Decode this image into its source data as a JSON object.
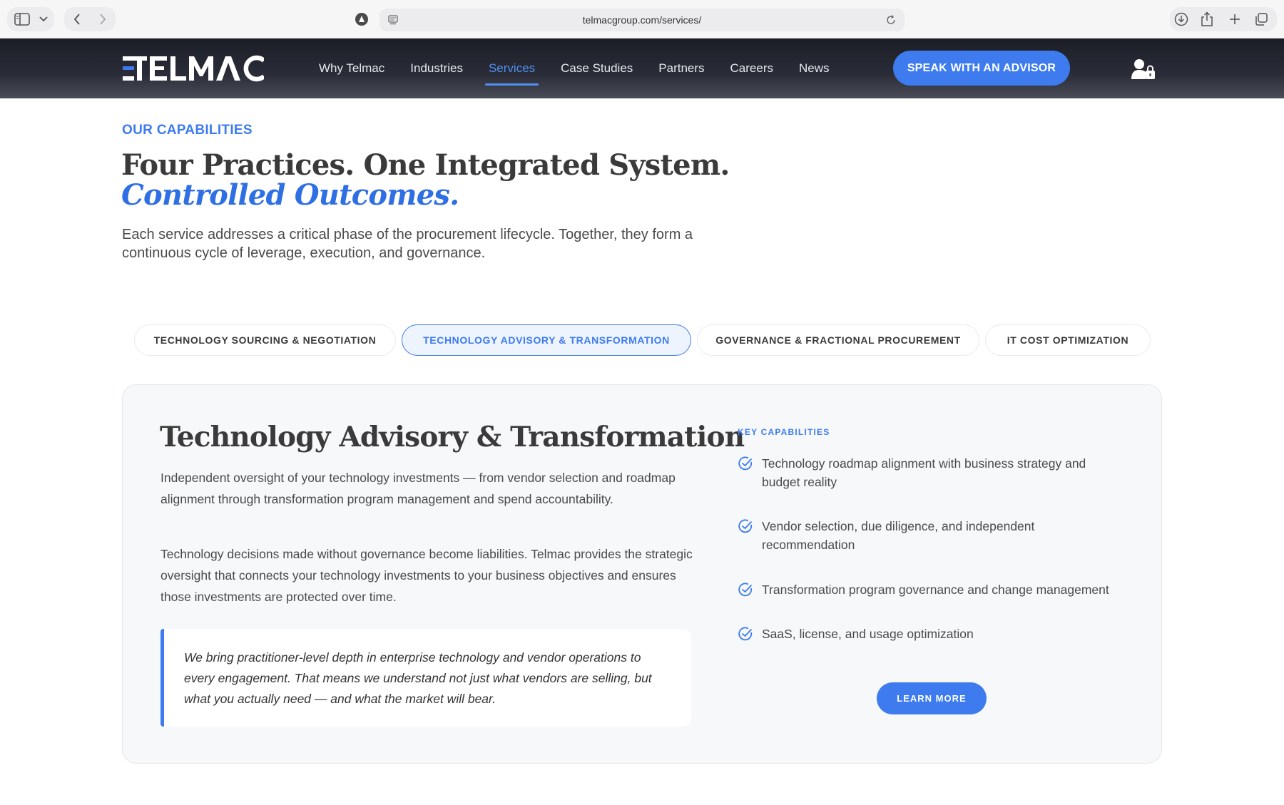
{
  "browser": {
    "url": "telmacgroup.com/services/"
  },
  "header": {
    "logo_text": "TELMAC",
    "nav": [
      {
        "label": "Why Telmac"
      },
      {
        "label": "Industries"
      },
      {
        "label": "Services"
      },
      {
        "label": "Case Studies"
      },
      {
        "label": "Partners"
      },
      {
        "label": "Careers"
      },
      {
        "label": "News"
      }
    ],
    "active_nav": "Services",
    "cta_label": "SPEAK WITH AN ADVISOR"
  },
  "intro": {
    "eyebrow": "OUR CAPABILITIES",
    "headline": "Four Practices. One Integrated System.",
    "headline_accent": "Controlled Outcomes.",
    "text": "Each service addresses a critical phase of the procurement lifecycle. Together, they form a continuous cycle of leverage, execution, and governance."
  },
  "tabs": [
    {
      "label": "TECHNOLOGY SOURCING & NEGOTIATION"
    },
    {
      "label": "TECHNOLOGY ADVISORY & TRANSFORMATION"
    },
    {
      "label": "GOVERNANCE & FRACTIONAL PROCUREMENT"
    },
    {
      "label": "IT COST OPTIMIZATION"
    }
  ],
  "active_tab": "TECHNOLOGY ADVISORY & TRANSFORMATION",
  "panel": {
    "title": "Technology Advisory & Transformation",
    "paragraph1": "Independent oversight of your technology investments — from vendor selection and roadmap alignment through transformation program management and spend accountability.",
    "paragraph2": "Technology decisions made without governance become liabilities. Telmac provides the strategic oversight that connects your technology investments to your business objectives and ensures those investments are protected over time.",
    "quote": "We bring practitioner-level depth in enterprise technology and vendor operations to every engagement. That means we understand not just what vendors are selling, but what you actually need — and what the market will bear.",
    "key_capabilities_label": "KEY CAPABILITIES",
    "capabilities": [
      "Technology roadmap alignment with business strategy and budget reality",
      "Vendor selection, due diligence, and independent recommendation",
      "Transformation program governance and change management",
      "SaaS, license, and usage optimization"
    ],
    "learn_more_label": "LEARN MORE"
  },
  "colors": {
    "accent": "#3d7bef",
    "header_bg": "#1b1d26",
    "panel_bg": "#f7f8fa"
  }
}
